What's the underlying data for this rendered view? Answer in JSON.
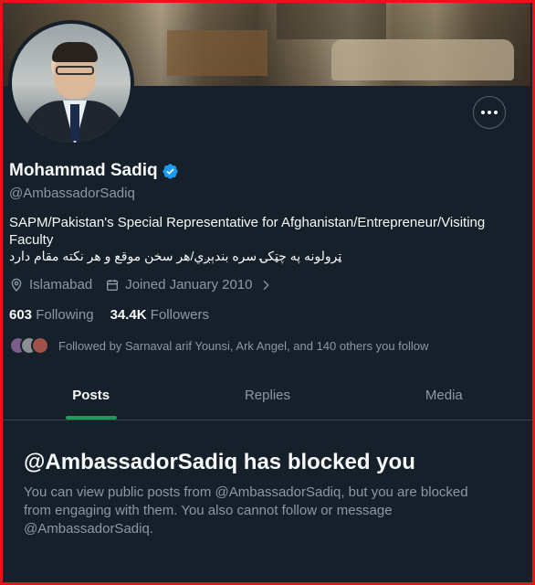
{
  "profile": {
    "name": "Mohammad Sadiq",
    "handle": "@AmbassadorSadiq",
    "bio": "SAPM/Pakistan's Special Representative for Afghanistan/Entrepreneur/Visiting Faculty",
    "bio_urdu": "ټرولونه په چټکۍ سره بندېږي/هر سخن موقع و هر نکته مقام دارد",
    "location": "Islamabad",
    "joined": "Joined January 2010",
    "following_count": "603",
    "following_label": "Following",
    "followers_count": "34.4K",
    "followers_label": "Followers",
    "followed_by": "Followed by Sarnaval arif Younsi, Ark Angel, and 140 others you follow"
  },
  "tabs": [
    {
      "label": "Posts"
    },
    {
      "label": "Replies"
    },
    {
      "label": "Media"
    }
  ],
  "blocked": {
    "title": "@AmbassadorSadiq has blocked you",
    "message": "You can view public posts from @AmbassadorSadiq, but you are blocked from engaging with them. You also cannot follow or message @AmbassadorSadiq."
  },
  "colors": {
    "background": "#15202b",
    "verified": "#1d9bf0",
    "tab_indicator": "#1d9b5b",
    "frame": "#e8141b"
  },
  "icons": [
    "more-icon",
    "verified-icon",
    "location-icon",
    "calendar-icon",
    "chevron-right-icon"
  ]
}
